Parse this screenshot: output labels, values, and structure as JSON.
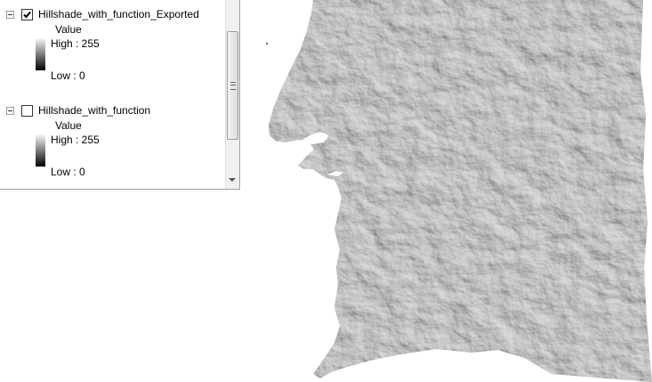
{
  "toc": {
    "layers": [
      {
        "name": "Hillshade_with_function_Exported",
        "checked": true,
        "legend_heading": "Value",
        "high_label": "High : 255",
        "low_label": "Low : 0"
      },
      {
        "name": "Hillshade_with_function",
        "checked": false,
        "legend_heading": "Value",
        "high_label": "High : 255",
        "low_label": "Low : 0"
      }
    ]
  },
  "colors": {
    "hillshade_base": "#bdbdbd",
    "background": "#ffffff"
  },
  "icons": {
    "expander": "minus-box-icon",
    "checkbox": "checkmark-icon",
    "scroll_grip": "grip-lines-icon",
    "scroll_down": "triangle-down-icon"
  }
}
